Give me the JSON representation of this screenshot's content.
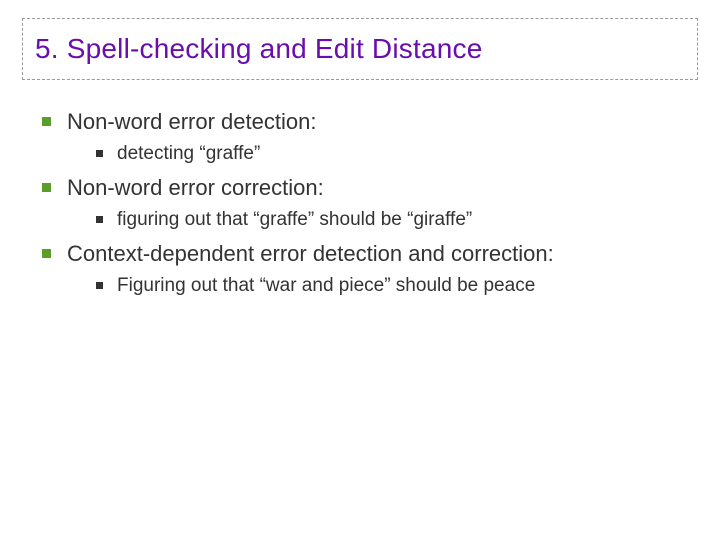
{
  "title": "5. Spell-checking and Edit Distance",
  "bullets": [
    {
      "text": "Non-word error detection:",
      "children": [
        {
          "text": "detecting “graffe”"
        }
      ]
    },
    {
      "text": "Non-word error correction:",
      "children": [
        {
          "text": "figuring out that “graffe” should be “giraffe”"
        }
      ]
    },
    {
      "text": "Context-dependent error detection and correction:",
      "children": [
        {
          "text": "Figuring out that “war and piece” should be peace"
        }
      ]
    }
  ]
}
